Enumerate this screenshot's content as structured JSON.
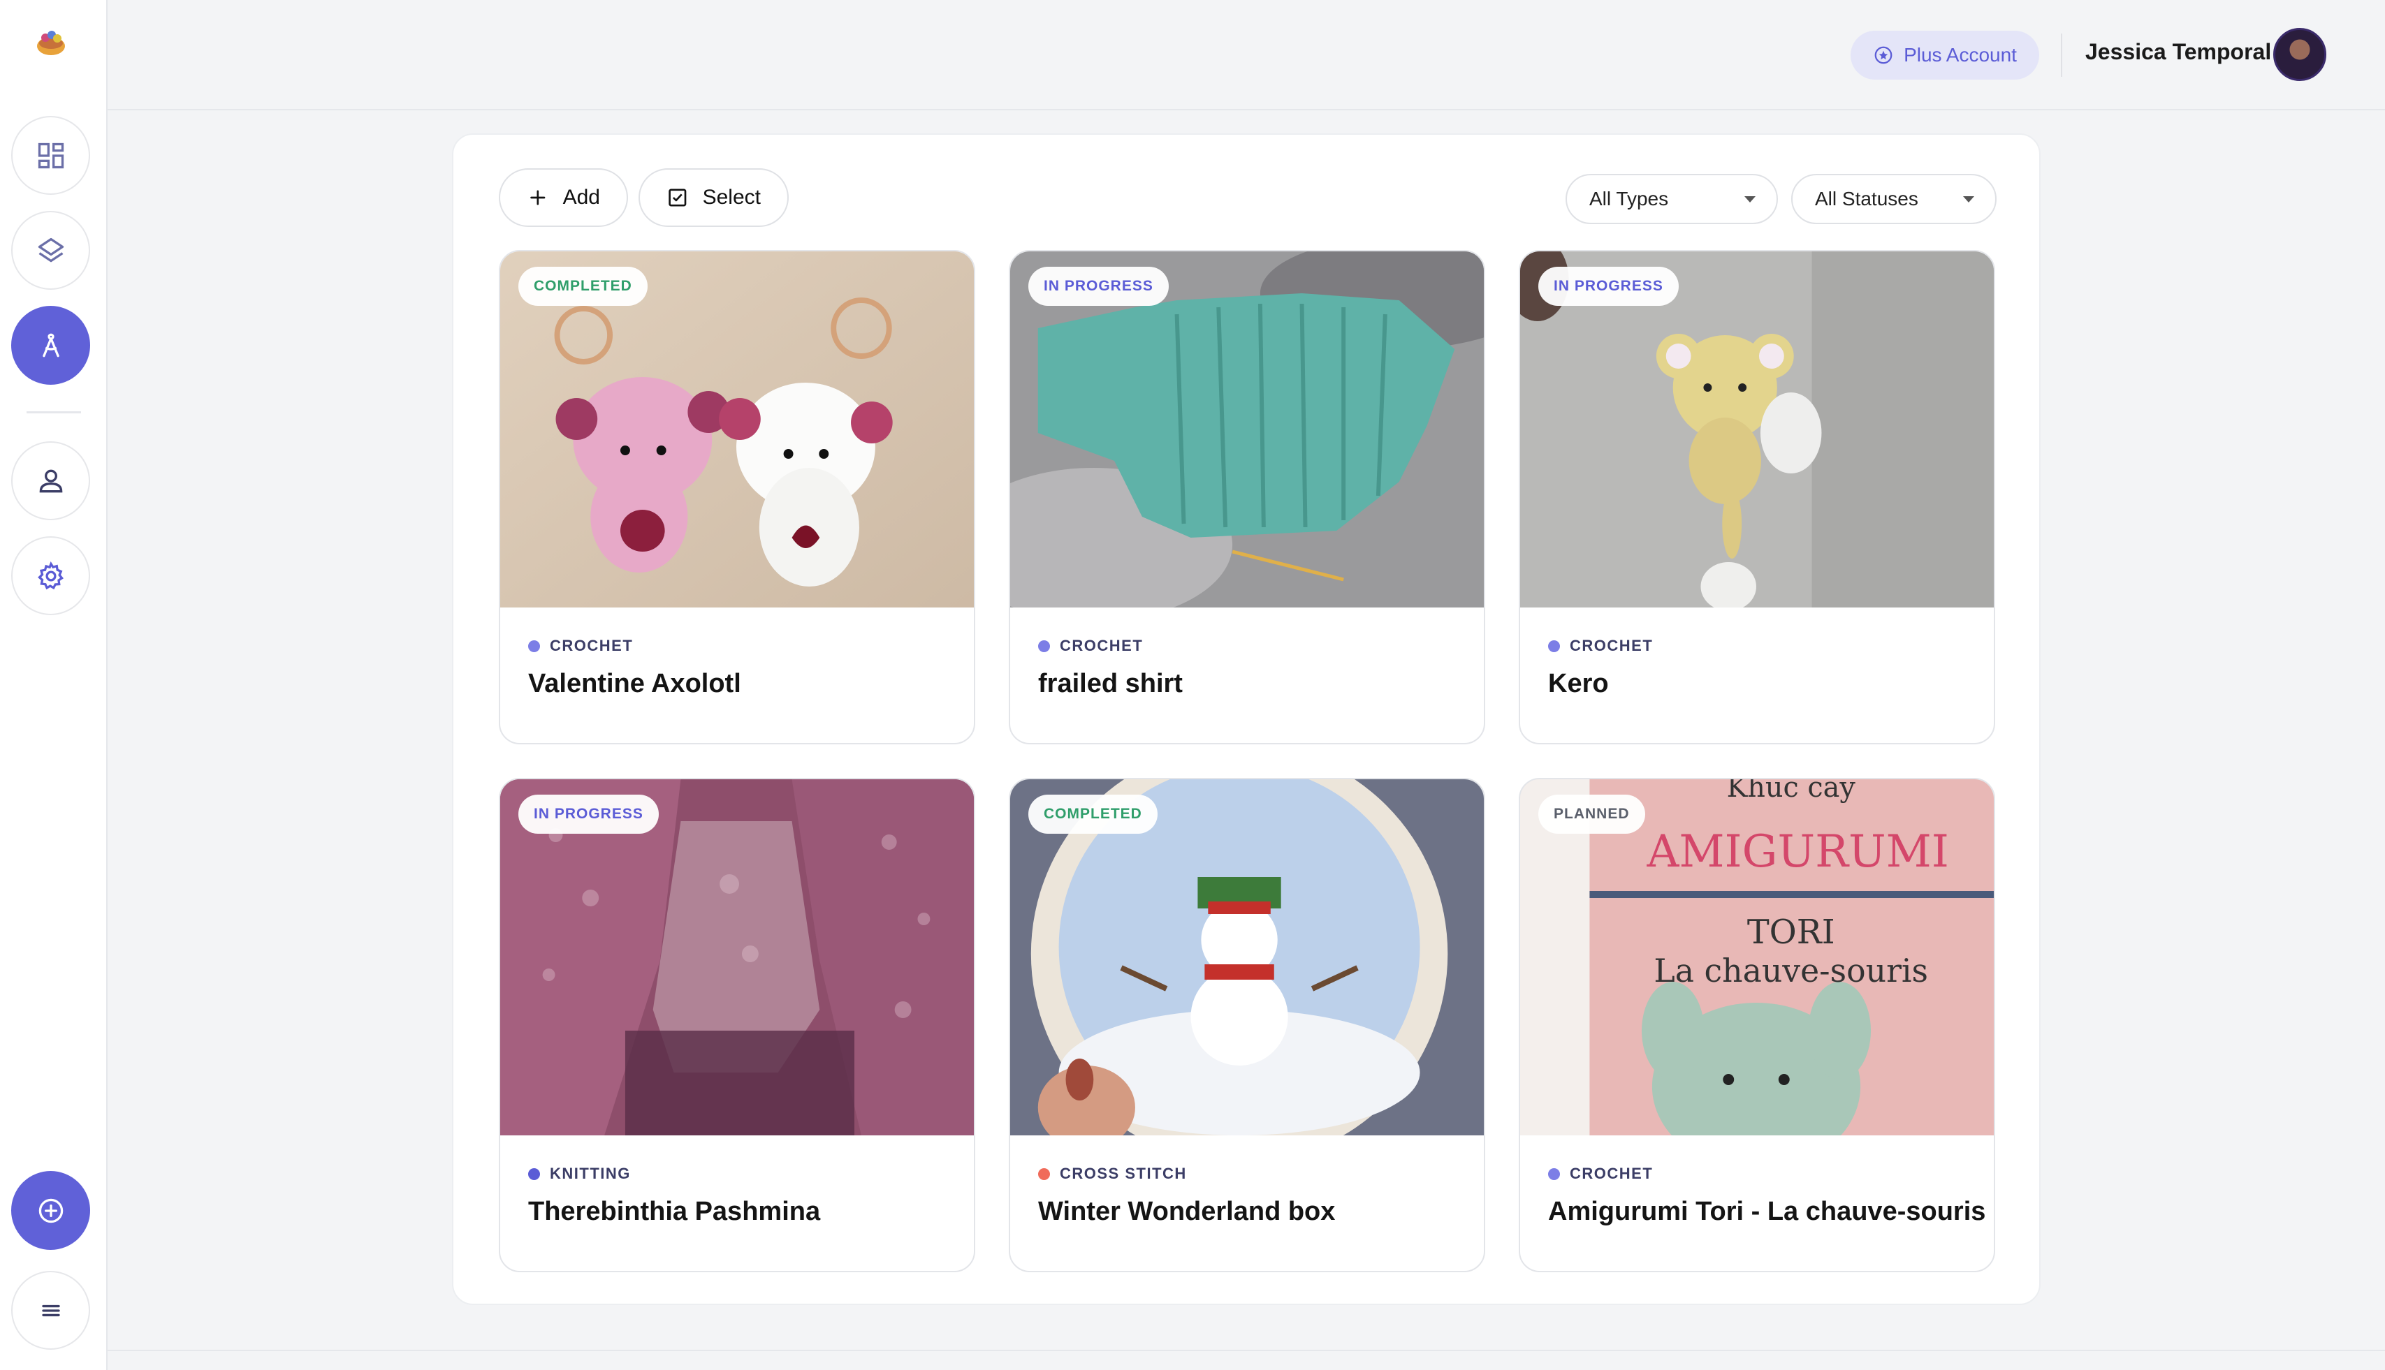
{
  "header": {
    "plus_label": "Plus Account",
    "user_name": "Jessica Temporal"
  },
  "sidebar": {
    "items": [
      {
        "icon": "dashboard-icon"
      },
      {
        "icon": "layers-icon"
      },
      {
        "icon": "compass-icon",
        "active": true
      },
      {
        "icon": "user-icon"
      },
      {
        "icon": "gear-icon"
      }
    ],
    "bottom": [
      {
        "icon": "add-circle-icon"
      },
      {
        "icon": "menu-icon"
      }
    ]
  },
  "toolbar": {
    "add_label": "Add",
    "select_label": "Select",
    "type_filter": "All Types",
    "status_filter": "All Statuses"
  },
  "projects": [
    {
      "status": "COMPLETED",
      "craft": "CROCHET",
      "title": "Valentine Axolotl"
    },
    {
      "status": "IN PROGRESS",
      "craft": "CROCHET",
      "title": "frailed shirt"
    },
    {
      "status": "IN PROGRESS",
      "craft": "CROCHET",
      "title": "Kero"
    },
    {
      "status": "IN PROGRESS",
      "craft": "KNITTING",
      "title": "Therebinthia Pashmina"
    },
    {
      "status": "COMPLETED",
      "craft": "CROSS STITCH",
      "title": "Winter Wonderland box"
    },
    {
      "status": "PLANNED",
      "craft": "CROCHET",
      "title": "Amigurumi Tori - La chauve-souris"
    }
  ],
  "colors": {
    "accent": "#6061d8",
    "completed": "#2f9e6a",
    "in_progress": "#5b5cd6",
    "cross_stitch_dot": "#f06b5a"
  }
}
